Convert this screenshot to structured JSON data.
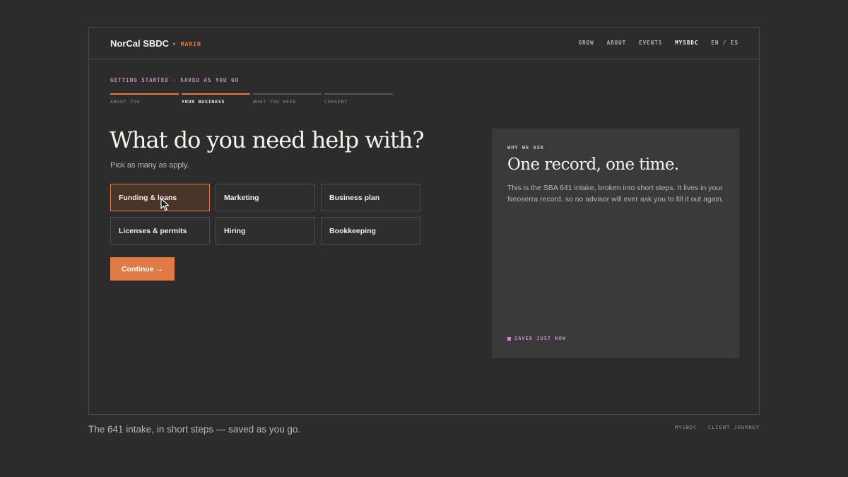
{
  "header": {
    "brand": "NorCal SBDC",
    "brand_sub": "× MARIN",
    "nav": [
      "GROW",
      "ABOUT",
      "EVENTS",
      "MYSBDC",
      "EN / ES"
    ]
  },
  "eyebrow": "GETTING STARTED · SAVED AS YOU GO",
  "steps": [
    {
      "label": "ABOUT YOU",
      "state": "done"
    },
    {
      "label": "YOUR BUSINESS",
      "state": "current"
    },
    {
      "label": "WHAT YOU NEED",
      "state": "todo"
    },
    {
      "label": "CONSENT",
      "state": "todo"
    }
  ],
  "main": {
    "title": "What do you need help with?",
    "hint": "Pick as many as apply.",
    "options": [
      {
        "label": "Funding & loans",
        "selected": true
      },
      {
        "label": "Marketing",
        "selected": false
      },
      {
        "label": "Business plan",
        "selected": false
      },
      {
        "label": "Licenses & permits",
        "selected": false
      },
      {
        "label": "Hiring",
        "selected": false
      },
      {
        "label": "Bookkeeping",
        "selected": false
      }
    ],
    "continue_label": "Continue →"
  },
  "aside": {
    "kicker": "WHY WE ASK",
    "title": "One record, one time.",
    "body": "This is the SBA 641 intake, broken into short steps. It lives in your Neoserra record, so no advisor will ever ask you to fill it out again.",
    "saved": "SAVED JUST NOW"
  },
  "footer": {
    "caption": "The 641 intake, in short steps — saved as you go.",
    "note": "MYSBDC · CLIENT JOURNEY"
  },
  "colors": {
    "accent": "#e07a47",
    "lavender": "#c38fc4",
    "background": "#2c2c2c",
    "panel": "#3a3a3a"
  }
}
